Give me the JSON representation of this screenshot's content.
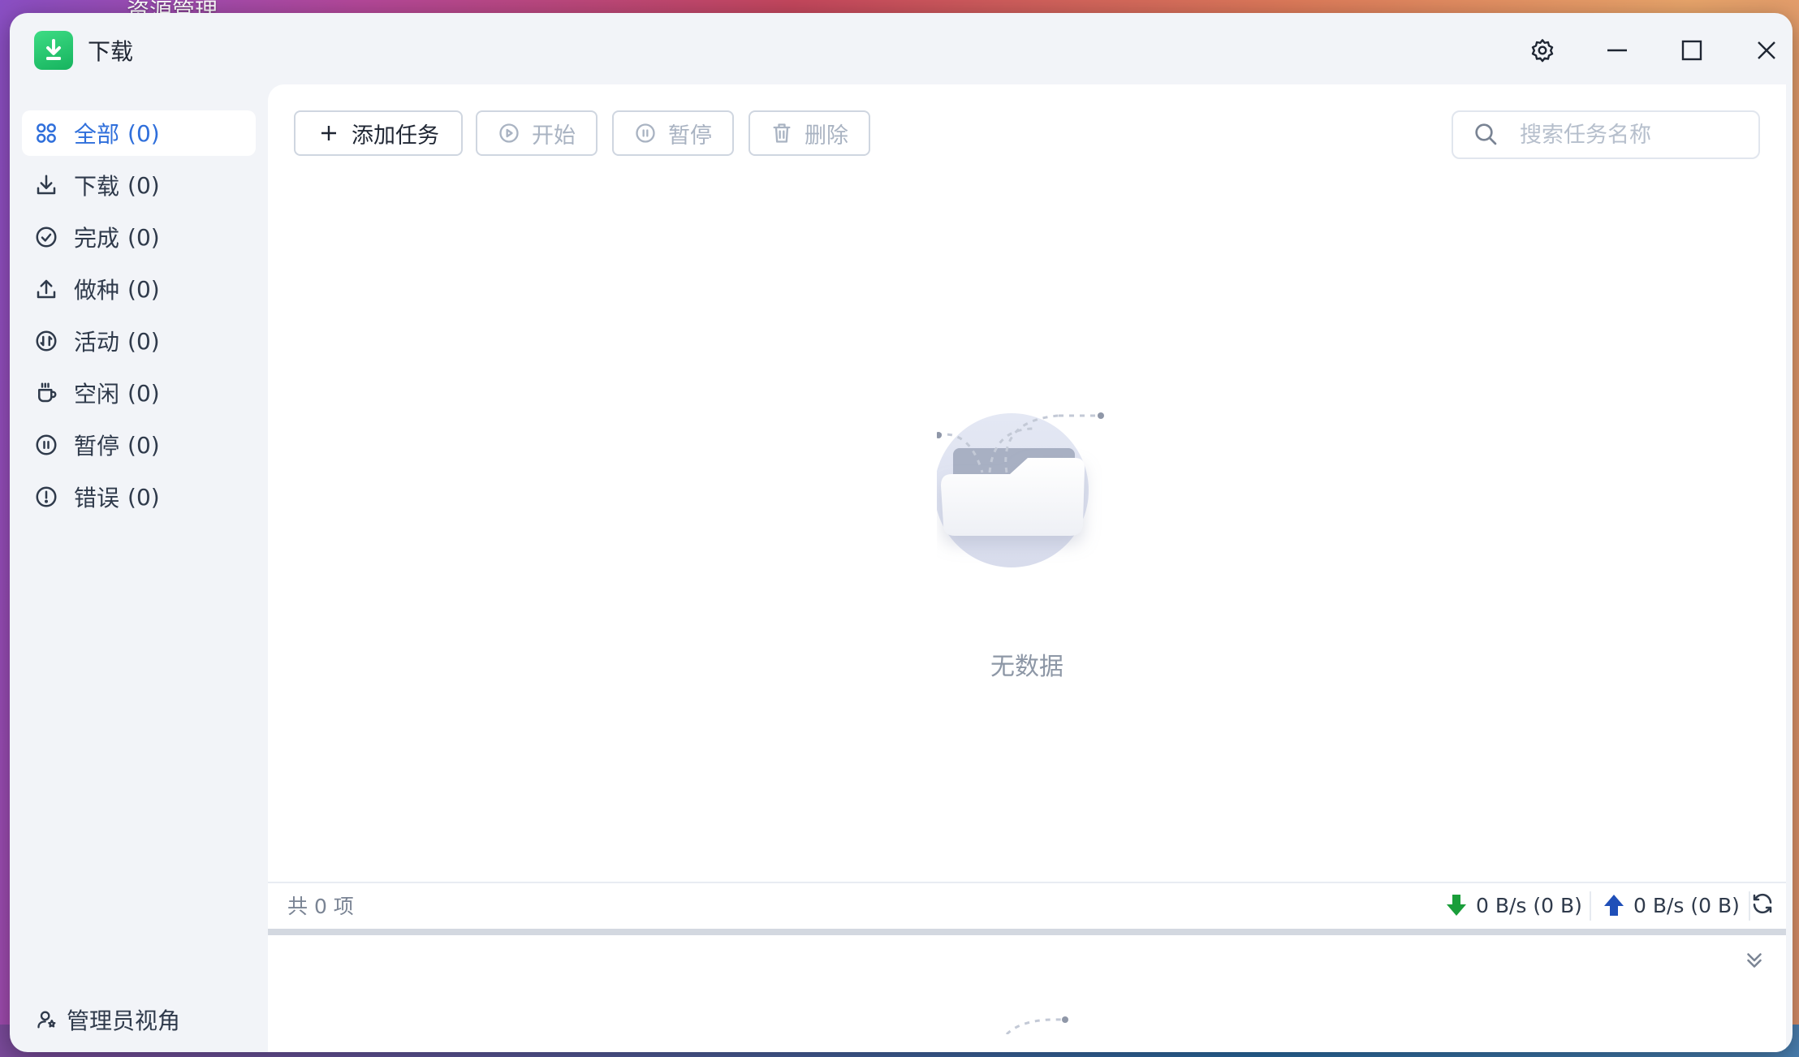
{
  "desktop": {
    "top_text": "资源管理"
  },
  "window": {
    "title": "下载"
  },
  "sidebar": {
    "items": [
      {
        "label": "全部",
        "count": "(0)",
        "icon": "grid-icon"
      },
      {
        "label": "下载",
        "count": "(0)",
        "icon": "download-icon"
      },
      {
        "label": "完成",
        "count": "(0)",
        "icon": "check-circle-icon"
      },
      {
        "label": "做种",
        "count": "(0)",
        "icon": "upload-icon"
      },
      {
        "label": "活动",
        "count": "(0)",
        "icon": "activity-icon"
      },
      {
        "label": "空闲",
        "count": "(0)",
        "icon": "cup-icon"
      },
      {
        "label": "暂停",
        "count": "(0)",
        "icon": "pause-circle-icon"
      },
      {
        "label": "错误",
        "count": "(0)",
        "icon": "alert-circle-icon"
      }
    ],
    "admin_label": "管理员视角"
  },
  "toolbar": {
    "add_label": "添加任务",
    "start_label": "开始",
    "pause_label": "暂停",
    "delete_label": "删除",
    "search_placeholder": "搜索任务名称",
    "search_value": ""
  },
  "content": {
    "empty_text": "无数据"
  },
  "status": {
    "total": "共 0 项",
    "download_speed": "0 B/s (0 B)",
    "upload_speed": "0 B/s (0 B)"
  },
  "colors": {
    "accent": "#2f6fdb",
    "app_icon": "#1fc46a",
    "download_arrow": "#1a9e3a",
    "upload_arrow": "#1f4fb8"
  }
}
